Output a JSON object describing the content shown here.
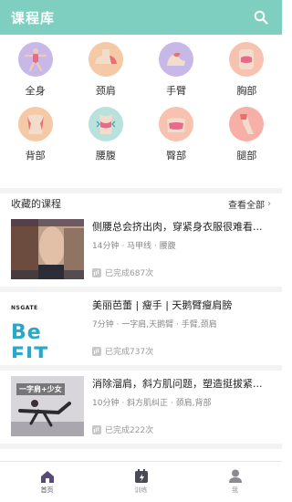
{
  "header": {
    "title": "课程库",
    "search_icon": "search-icon"
  },
  "body_parts": [
    {
      "label": "全身",
      "icon": "full-body-icon",
      "color": "#c8b8e8"
    },
    {
      "label": "颈肩",
      "icon": "neck-shoulder-icon",
      "color": "#f6c9a6"
    },
    {
      "label": "手臂",
      "icon": "arm-icon",
      "color": "#c8b8e8"
    },
    {
      "label": "胸部",
      "icon": "chest-icon",
      "color": "#f7c3b0"
    },
    {
      "label": "背部",
      "icon": "back-icon",
      "color": "#f6c9a6"
    },
    {
      "label": "腰腹",
      "icon": "waist-icon",
      "color": "#b9e2dd"
    },
    {
      "label": "臀部",
      "icon": "hip-icon",
      "color": "#f7c3b0"
    },
    {
      "label": "腿部",
      "icon": "leg-icon",
      "color": "#f7b0a8"
    }
  ],
  "favorites": {
    "title": "收藏的课程",
    "see_all": "查看全部",
    "courses": [
      {
        "title": "侧腰总会挤出肉，穿紧身衣服很难看...",
        "meta": "14分钟 · 马甲线 · 腰腹",
        "completed": "已完成687次"
      },
      {
        "title": "美丽芭蕾 | 瘦手 | 天鹅臂瘦肩膀",
        "meta": "7分钟 · 一字肩,天鹅臂 · 手臂,颈肩",
        "completed": "已完成737次",
        "thumb_top": "NSGATE",
        "thumb_brand": "Be FIT"
      },
      {
        "title": "消除溜肩，斜方肌问题，塑造挺拔紧...",
        "meta": "10分钟 · 斜方肌纠正 · 颈肩,背部",
        "completed": "已完成222次",
        "thumb_caption": "一字肩+少女"
      }
    ]
  },
  "tabbar": [
    {
      "label": "首页",
      "icon": "home-icon",
      "active": true
    },
    {
      "label": "训练",
      "icon": "training-icon",
      "active": false
    },
    {
      "label": "我",
      "icon": "profile-icon",
      "active": false
    }
  ],
  "colors": {
    "header_bg": "#7fcfc0",
    "active_tab": "#5a4a78",
    "accent_purple": "#8a7aa6"
  }
}
